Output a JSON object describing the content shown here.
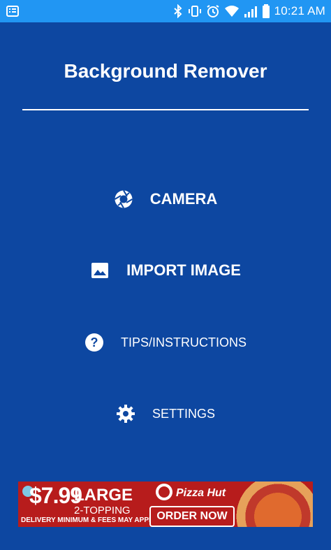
{
  "status_bar": {
    "time": "10:21 AM",
    "icons": [
      "notification-icon",
      "bluetooth-icon",
      "vibrate-icon",
      "alarm-icon",
      "wifi-icon",
      "signal-icon",
      "battery-icon"
    ]
  },
  "app": {
    "title": "Background Remover"
  },
  "menu": {
    "camera": "CAMERA",
    "import_image": "IMPORT IMAGE",
    "tips": "TIPS/INSTRUCTIONS",
    "settings": "SETTINGS"
  },
  "ad": {
    "price": "$7.99",
    "size": "LARGE",
    "topping": "2-TOPPING",
    "fine_print": "DELIVERY MINIMUM & FEES MAY APPLY.",
    "brand": "Pizza Hut",
    "cta": "ORDER NOW"
  },
  "colors": {
    "status_bar": "#2196f3",
    "background": "#0d47a1",
    "ad_red": "#b71c1c"
  }
}
